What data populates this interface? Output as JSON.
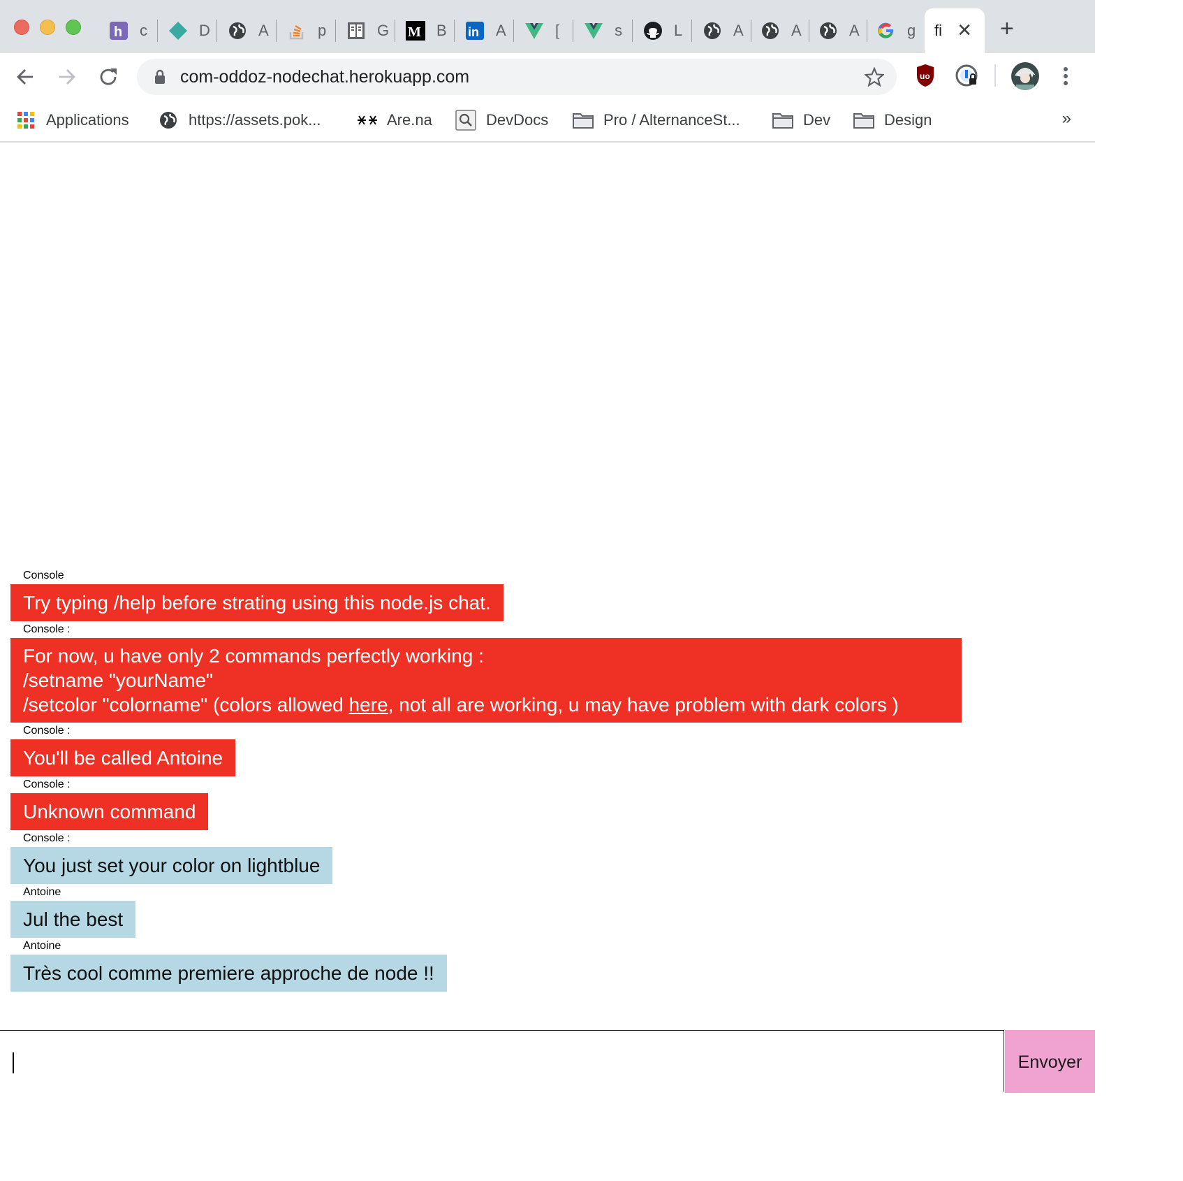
{
  "browser": {
    "tabs": [
      {
        "icon": "heroku-icon",
        "title": "c"
      },
      {
        "icon": "diamond-icon",
        "title": "D"
      },
      {
        "icon": "globe-icon",
        "title": "A"
      },
      {
        "icon": "stackoverflow-icon",
        "title": "p"
      },
      {
        "icon": "book-icon",
        "title": "G"
      },
      {
        "icon": "medium-icon",
        "title": "B"
      },
      {
        "icon": "linkedin-icon",
        "title": "A"
      },
      {
        "icon": "vue-icon",
        "title": "["
      },
      {
        "icon": "vue-icon",
        "title": "s"
      },
      {
        "icon": "github-icon",
        "title": "L"
      },
      {
        "icon": "globe-icon",
        "title": "A"
      },
      {
        "icon": "globe-icon",
        "title": "A"
      },
      {
        "icon": "globe-icon",
        "title": "A"
      },
      {
        "icon": "google-icon",
        "title": "g"
      }
    ],
    "active_tab": {
      "title": "fi"
    },
    "url": "com-oddoz-nodechat.herokuapp.com",
    "bookmarks": [
      {
        "icon": "apps-grid-icon",
        "label": "Applications"
      },
      {
        "icon": "globe-icon",
        "label": "https://assets.pok..."
      },
      {
        "icon": "arena-icon",
        "label": "Are.na"
      },
      {
        "icon": "devdocs-icon",
        "label": "DevDocs"
      },
      {
        "icon": "folder-icon",
        "label": "Pro / AlternanceSt..."
      },
      {
        "icon": "folder-icon",
        "label": "Dev"
      },
      {
        "icon": "folder-icon",
        "label": "Design"
      }
    ],
    "bookmarks_more": "»"
  },
  "chat": {
    "messages": [
      {
        "author": "Console",
        "color": "#ee3124",
        "text": "Try typing /help before strating using this node.js chat."
      },
      {
        "author": "Console :",
        "color": "#ee3124",
        "line1": "For now, u have only 2 commands perfectly working :",
        "line2": "/setname \"yourName\"",
        "line3_pre": "/setcolor \"colorname\" (colors allowed ",
        "line3_link": "here",
        "line3_post": ", not all are working, u may have problem with dark colors )"
      },
      {
        "author": "Console :",
        "color": "#ee3124",
        "text": "You'll be called Antoine"
      },
      {
        "author": "Console :",
        "color": "#ee3124",
        "text": "Unknown command"
      },
      {
        "author": "Console :",
        "color": "#b6d8e4",
        "text": "You just set your color on lightblue"
      },
      {
        "author": "Antoine",
        "color": "#b6d8e4",
        "text": "Jul the best"
      },
      {
        "author": "Antoine",
        "color": "#b6d8e4",
        "text": "Très cool comme premiere approche de node !!"
      }
    ],
    "input": {
      "value": "",
      "placeholder": ""
    },
    "send_label": "Envoyer",
    "send_color": "#f0a3d1"
  }
}
